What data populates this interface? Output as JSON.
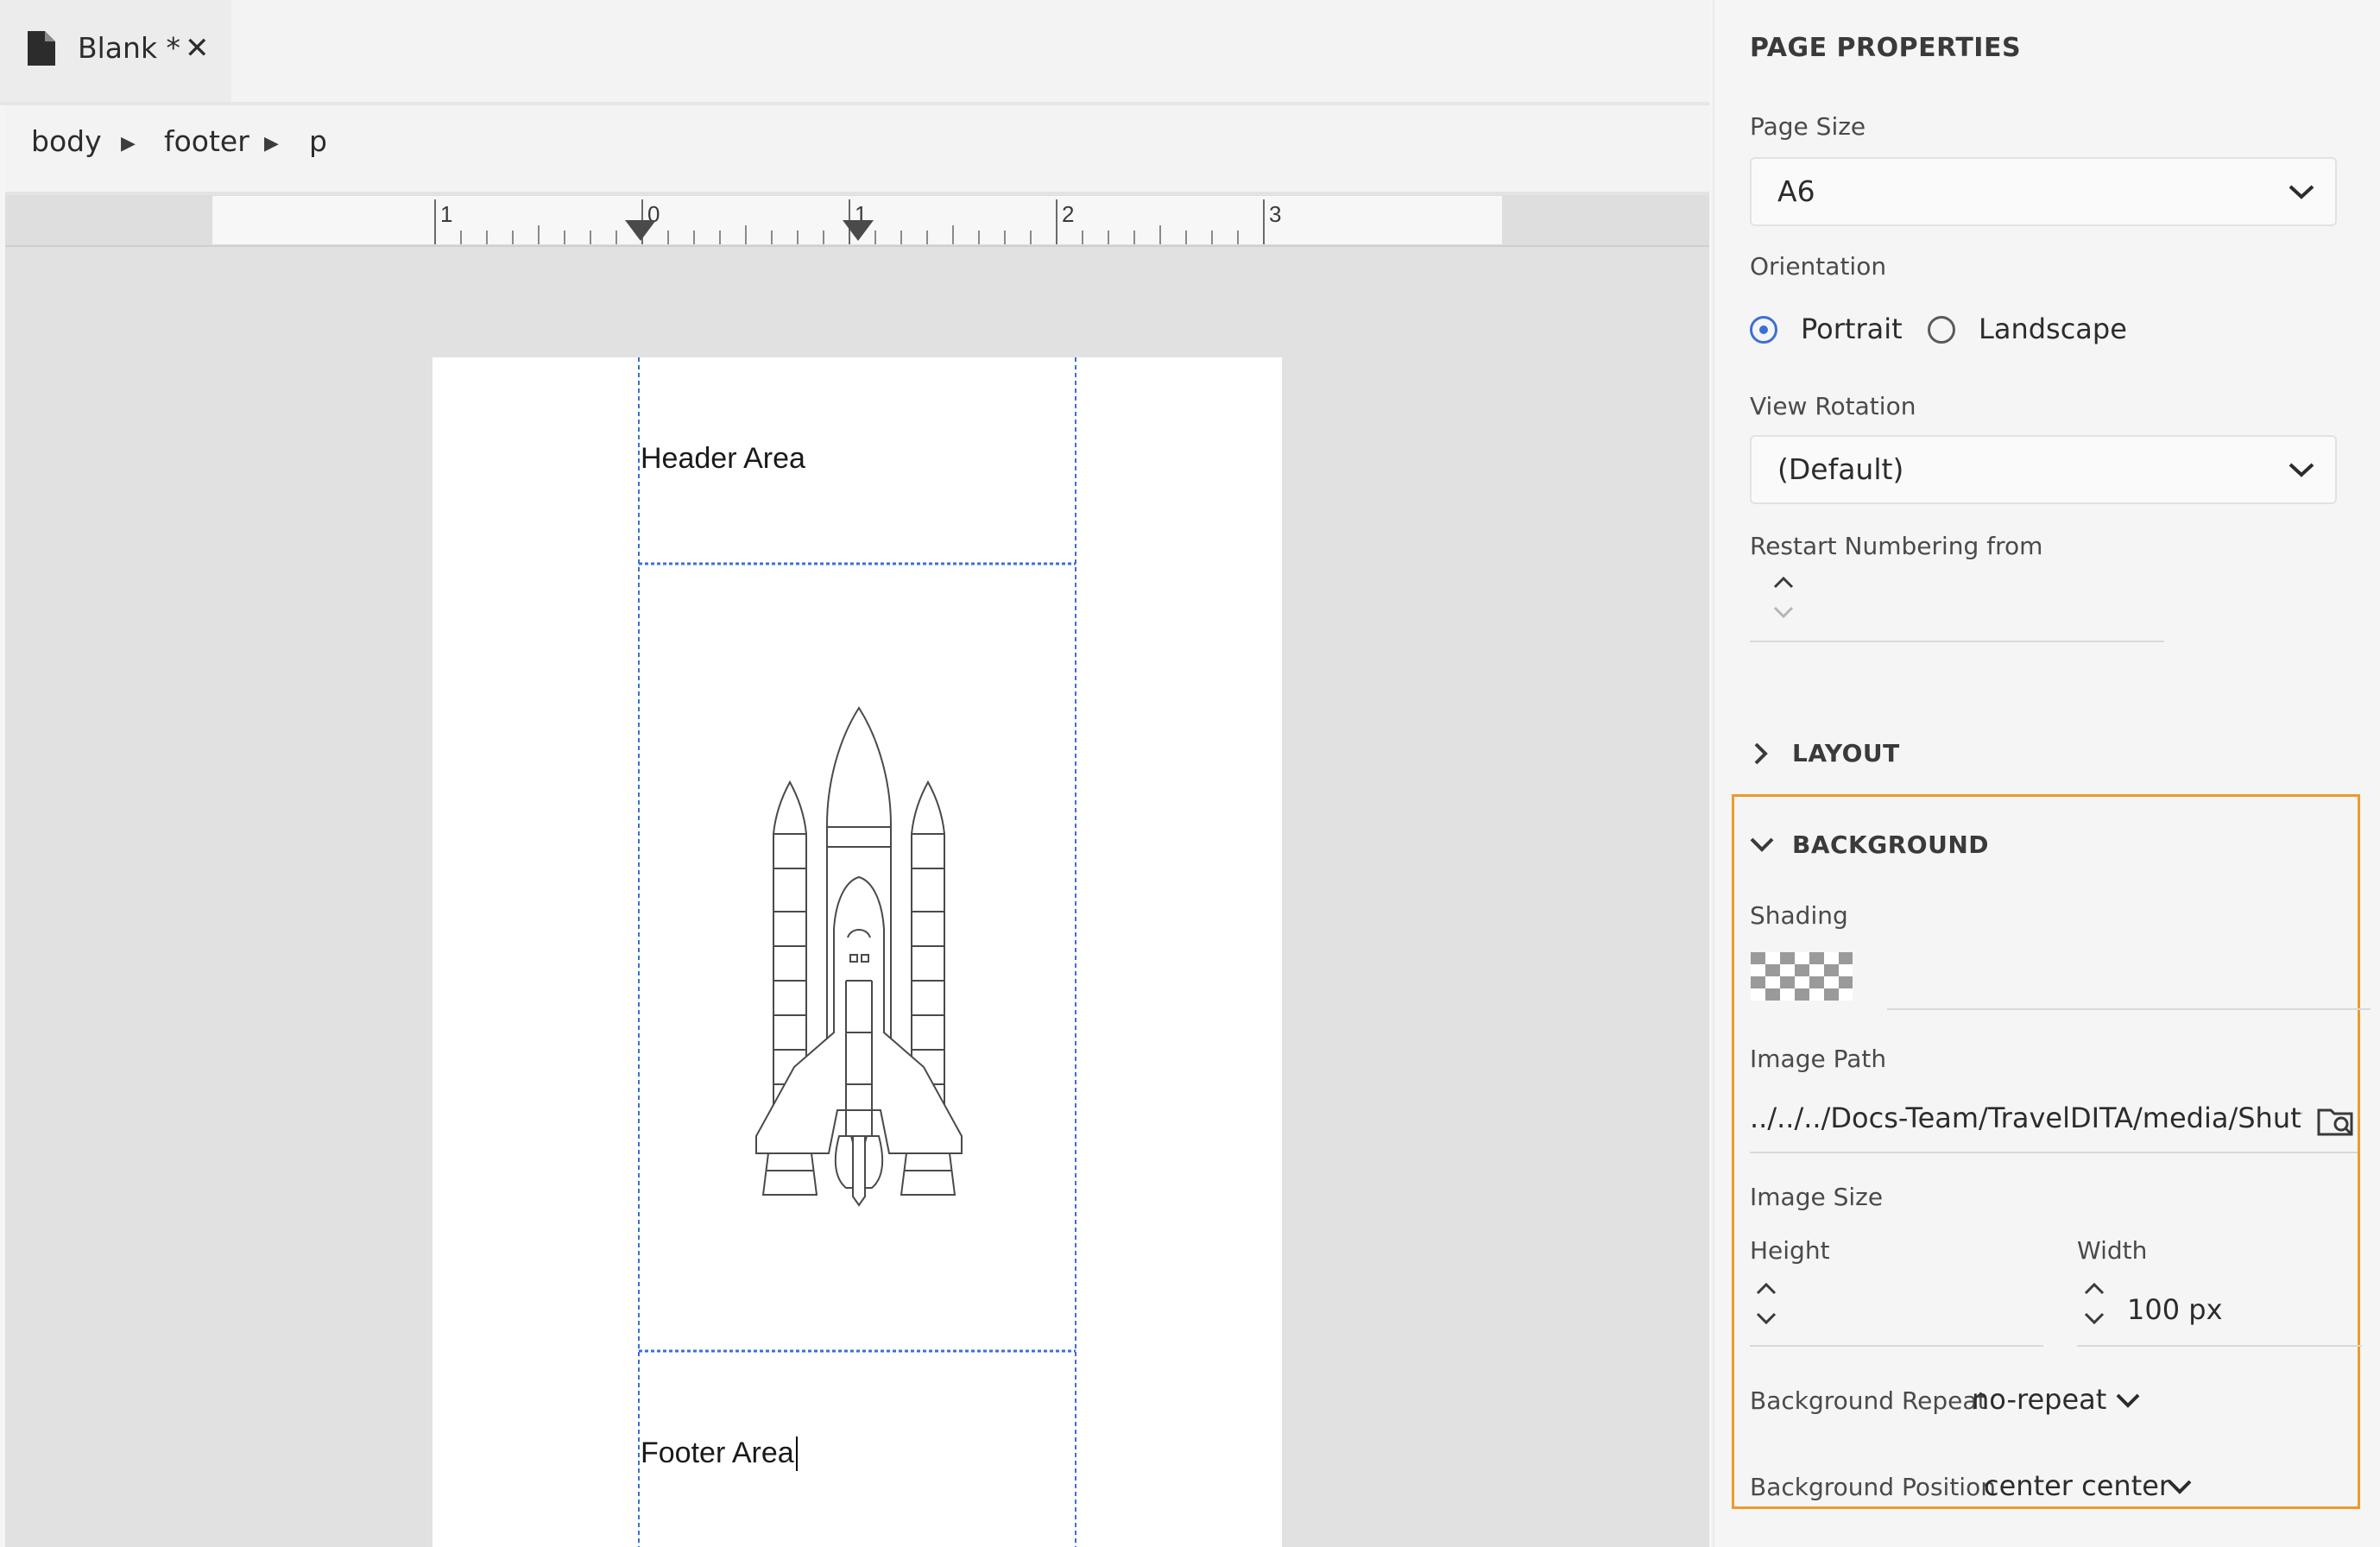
{
  "tab": {
    "title": "Blank *",
    "close": "✕",
    "icon": "file-icon"
  },
  "breadcrumb": [
    "body",
    "footer",
    "p"
  ],
  "breadcrumb_separator": "▶",
  "ruler": {
    "labels": [
      "1",
      "0",
      "1",
      "2",
      "3"
    ]
  },
  "page": {
    "header_text": "Header Area",
    "footer_text": "Footer Area",
    "image": "space-shuttle-image"
  },
  "panel": {
    "title": "PAGE PROPERTIES",
    "page_size": {
      "label": "Page Size",
      "value": "A6"
    },
    "orientation": {
      "label": "Orientation",
      "options": [
        {
          "label": "Portrait",
          "selected": true
        },
        {
          "label": "Landscape",
          "selected": false
        }
      ]
    },
    "view_rotation": {
      "label": "View Rotation",
      "value": "(Default)"
    },
    "restart_numbering": {
      "label": "Restart Numbering from",
      "value": ""
    },
    "layout": {
      "label": "LAYOUT",
      "expanded": false
    },
    "background": {
      "label": "BACKGROUND",
      "expanded": true,
      "shading": {
        "label": "Shading",
        "value": "transparent"
      },
      "image_path": {
        "label": "Image Path",
        "value": "../../../Docs-Team/TravelDITA/media/Shuttle..."
      },
      "image_size": {
        "label": "Image Size",
        "height": {
          "label": "Height",
          "value": ""
        },
        "width": {
          "label": "Width",
          "value": "100 px"
        }
      },
      "repeat": {
        "label": "Background Repeat",
        "value": "no-repeat"
      },
      "position": {
        "label": "Background Position",
        "value": "center center"
      }
    }
  },
  "colors": {
    "accent": "#3b6fd6",
    "highlight": "#ee9a2a",
    "guide": "#3b6fd6"
  }
}
